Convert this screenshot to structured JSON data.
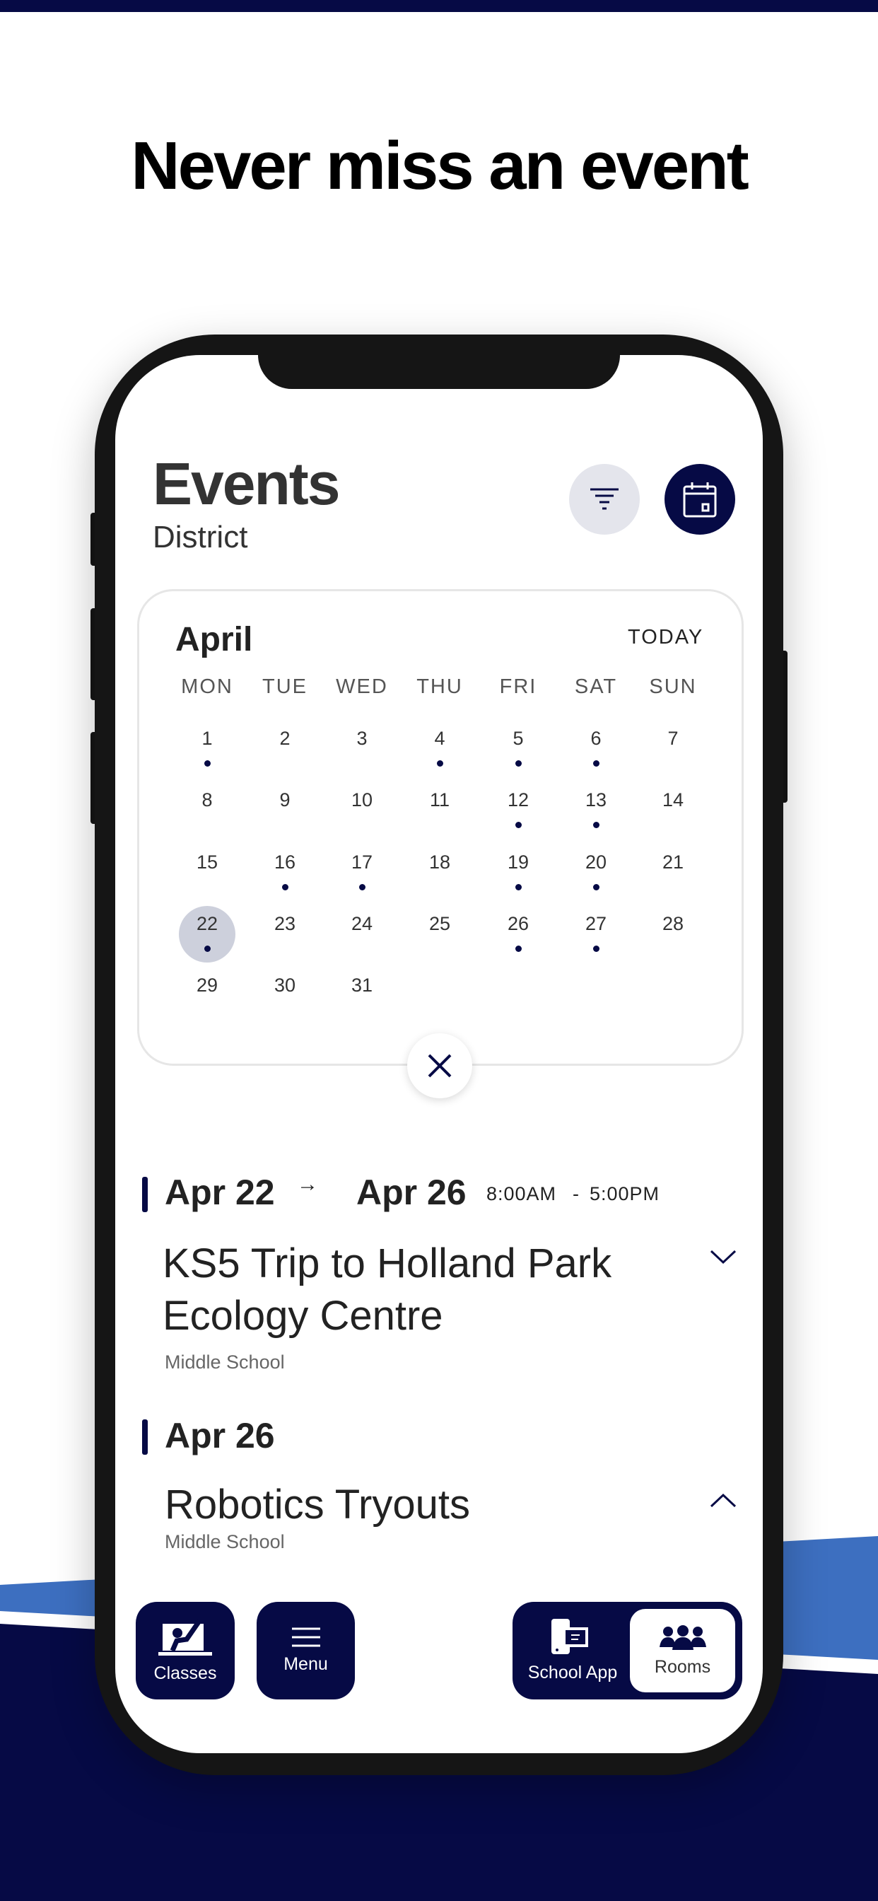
{
  "headline": "Never miss an event",
  "header": {
    "title": "Events",
    "subtitle": "District",
    "filter_icon": "filter-icon",
    "calendar_icon": "calendar-icon"
  },
  "calendar": {
    "month": "April",
    "today_label": "TODAY",
    "weekdays": [
      "MON",
      "TUE",
      "WED",
      "THU",
      "FRI",
      "SAT",
      "SUN"
    ],
    "first_weekday_index": 0,
    "days_in_month": 31,
    "selected_day": 22,
    "event_days": [
      1,
      4,
      5,
      6,
      12,
      13,
      16,
      17,
      19,
      20,
      22,
      26,
      27
    ]
  },
  "events": [
    {
      "start": "Apr 22",
      "end": "Apr 26",
      "time_start": "8:00AM",
      "time_sep": "-",
      "time_end": "5:00PM",
      "title": "KS5 Trip to Holland Park Ecology Centre",
      "audience": "Middle School",
      "expanded": false
    },
    {
      "start": "Apr 26",
      "title": "Robotics Tryouts",
      "audience": "Middle School",
      "expanded": true
    }
  ],
  "nav": {
    "classes": "Classes",
    "menu": "Menu",
    "school_app": "School App",
    "rooms": "Rooms",
    "active": "Rooms"
  },
  "colors": {
    "navy": "#060a45",
    "blue": "#3d6fc0",
    "selected_day": "#cdd0dc"
  }
}
